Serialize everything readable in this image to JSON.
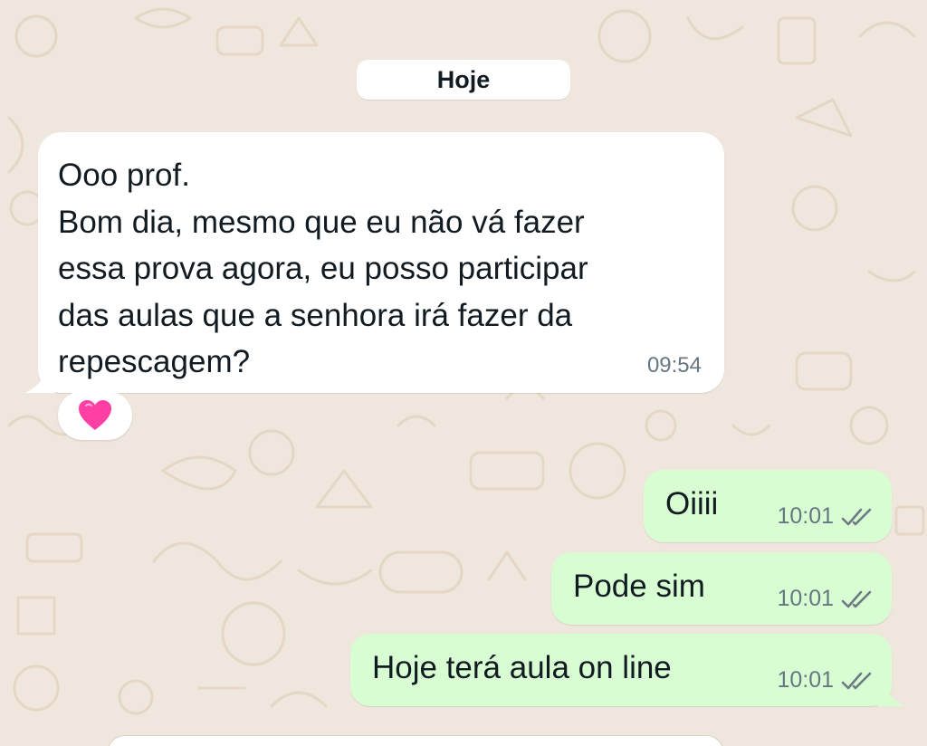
{
  "chat": {
    "day_separator": "Hoje",
    "incoming": {
      "lines": [
        "Ooo prof.",
        "Bom dia, mesmo que eu não vá fazer",
        "essa prova agora, eu posso participar",
        "das aulas que a senhora irá fazer da",
        "repescagem?"
      ],
      "time": "09:54",
      "reaction": "heart-icon"
    },
    "outgoing": [
      {
        "text": "Oiiii",
        "time": "10:01",
        "status": "read-double-check-icon"
      },
      {
        "text": "Pode sim",
        "time": "10:01",
        "status": "read-double-check-icon"
      },
      {
        "text": "Hoje terá aula on line",
        "time": "10:01",
        "status": "read-double-check-icon"
      }
    ]
  },
  "colors": {
    "wallpaper": "#efe7dd",
    "incoming_bubble": "#ffffff",
    "outgoing_bubble": "#d9fdd3",
    "reaction_heart": "#ff3fa4",
    "meta_text": "#667781"
  }
}
